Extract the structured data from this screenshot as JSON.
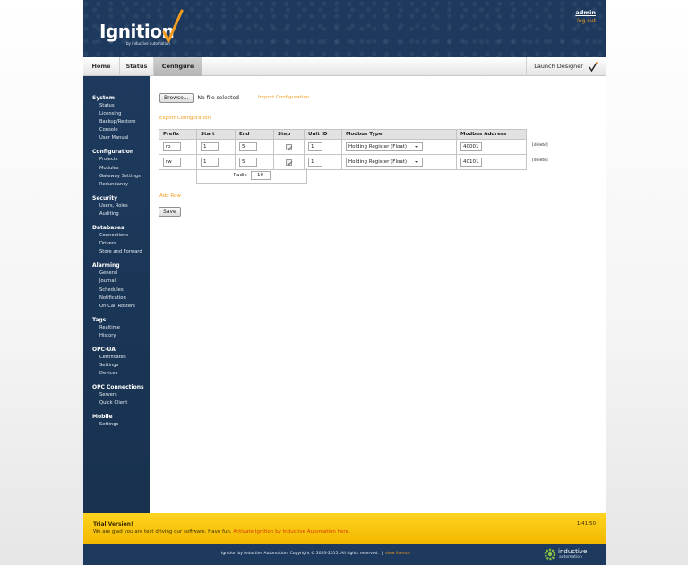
{
  "header": {
    "logo_text": "Ignition",
    "logo_sub": "by inductive automation",
    "user": "admin",
    "logout": "log out"
  },
  "nav": {
    "tabs": [
      {
        "label": "Home"
      },
      {
        "label": "Status"
      },
      {
        "label": "Configure",
        "active": true
      }
    ],
    "launch": "Launch Designer"
  },
  "sidebar": {
    "sections": [
      {
        "title": "System",
        "items": [
          "Status",
          "Licensing",
          "Backup/Restore",
          "Console",
          "User Manual"
        ]
      },
      {
        "title": "Configuration",
        "items": [
          "Projects",
          "Modules",
          "Gateway Settings",
          "Redundancy"
        ]
      },
      {
        "title": "Security",
        "items": [
          "Users, Roles",
          "Auditing"
        ]
      },
      {
        "title": "Databases",
        "items": [
          "Connections",
          "Drivers",
          "Store and Forward"
        ]
      },
      {
        "title": "Alarming",
        "items": [
          "General",
          "Journal",
          "Schedules",
          "Notification",
          "On-Call Rosters"
        ]
      },
      {
        "title": "Tags",
        "items": [
          "Realtime",
          "History"
        ]
      },
      {
        "title": "OPC-UA",
        "items": [
          "Certificates",
          "Settings",
          "Devices"
        ]
      },
      {
        "title": "OPC Connections",
        "items": [
          "Servers",
          "Quick Client"
        ]
      },
      {
        "title": "Mobile",
        "items": [
          "Settings"
        ]
      }
    ]
  },
  "content": {
    "browse_label": "Browse...",
    "no_file": "No file selected",
    "import_link": "Import Configuration",
    "export_link": "Export Configuration",
    "columns": [
      "Prefix",
      "Start",
      "End",
      "Step",
      "Unit ID",
      "Modbus Type",
      "Modbus Address"
    ],
    "rows": [
      {
        "prefix": "ro",
        "start": "1",
        "end": "5",
        "unit_id": "1",
        "type": "Holding Register (Float)",
        "address": "40001",
        "delete": "[delete]"
      },
      {
        "prefix": "rw",
        "start": "1",
        "end": "5",
        "unit_id": "1",
        "type": "Holding Register (Float)",
        "address": "40101",
        "delete": "[delete]"
      }
    ],
    "radix_label": "Radix",
    "radix_value": "10",
    "add_row": "Add Row",
    "save": "Save"
  },
  "trial": {
    "title": "Trial Version!",
    "message": "We are glad you are test driving our software. Have fun.",
    "activate_link": "Activate Ignition by Inductive Automation here.",
    "time": "1:41:50"
  },
  "footer": {
    "copyright": "Ignition by Inductive Automation. Copyright © 2003-2015. All rights reserved.",
    "view_license": "view license",
    "brand1": "inductive",
    "brand2": "automation"
  },
  "colors": {
    "navy": "#1d3a5e",
    "accent_orange": "#f29c1f",
    "trial_yellow": "#ffd41f"
  }
}
